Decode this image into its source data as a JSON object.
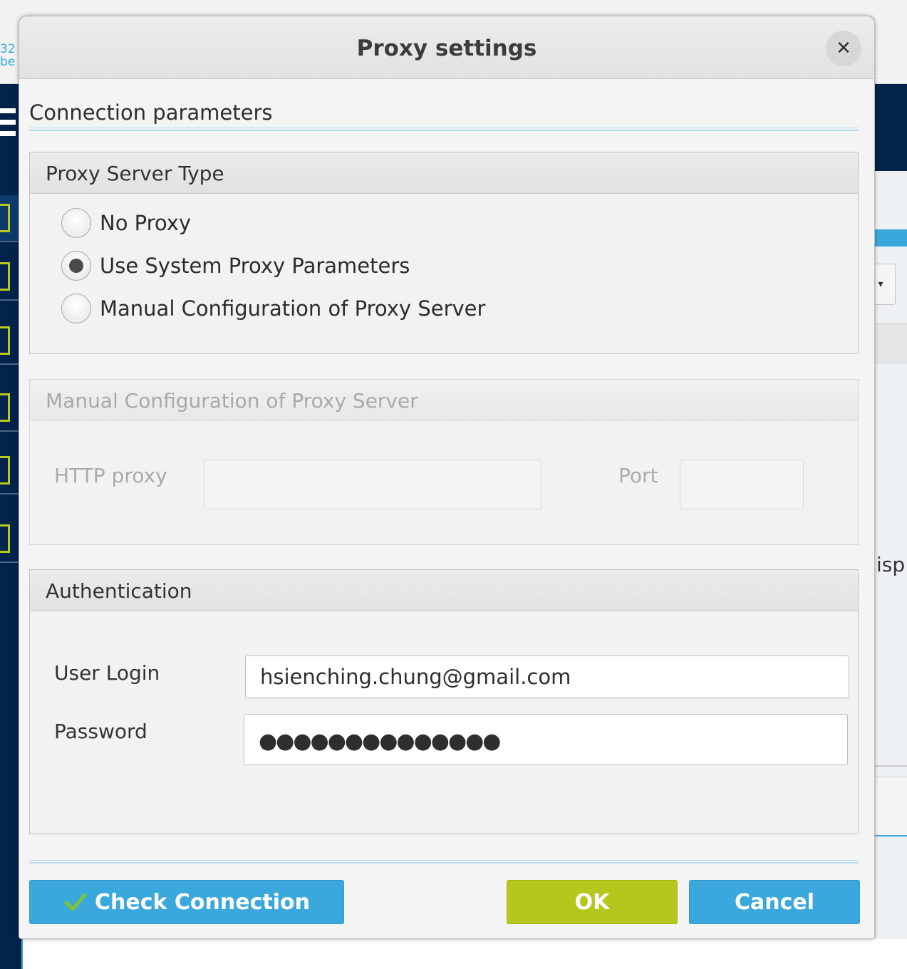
{
  "background": {
    "logo_text": "32\nbe",
    "right_partial_text": "isp"
  },
  "dialog": {
    "title": "Proxy settings",
    "close_glyph": "✕"
  },
  "connection": {
    "section_title": "Connection parameters"
  },
  "proxy_type": {
    "header": "Proxy Server Type",
    "options": [
      {
        "label": "No Proxy",
        "selected": false
      },
      {
        "label": "Use System Proxy Parameters",
        "selected": true
      },
      {
        "label": "Manual Configuration of Proxy Server",
        "selected": false
      }
    ]
  },
  "manual_config": {
    "header": "Manual Configuration of Proxy Server",
    "http_proxy_label": "HTTP proxy",
    "http_proxy_value": "",
    "port_label": "Port",
    "port_value": "",
    "enabled": false
  },
  "authentication": {
    "header": "Authentication",
    "user_login_label": "User Login",
    "user_login_value": "hsienching.chung@gmail.com",
    "password_label": "Password",
    "password_masked": "●●●●●●●●●●●●●●"
  },
  "buttons": {
    "check_connection": "Check Connection",
    "ok": "OK",
    "cancel": "Cancel"
  },
  "colors": {
    "accent_blue": "#3aa8dc",
    "ok_green": "#b4c71d",
    "sidebar_navy": "#03234b"
  }
}
